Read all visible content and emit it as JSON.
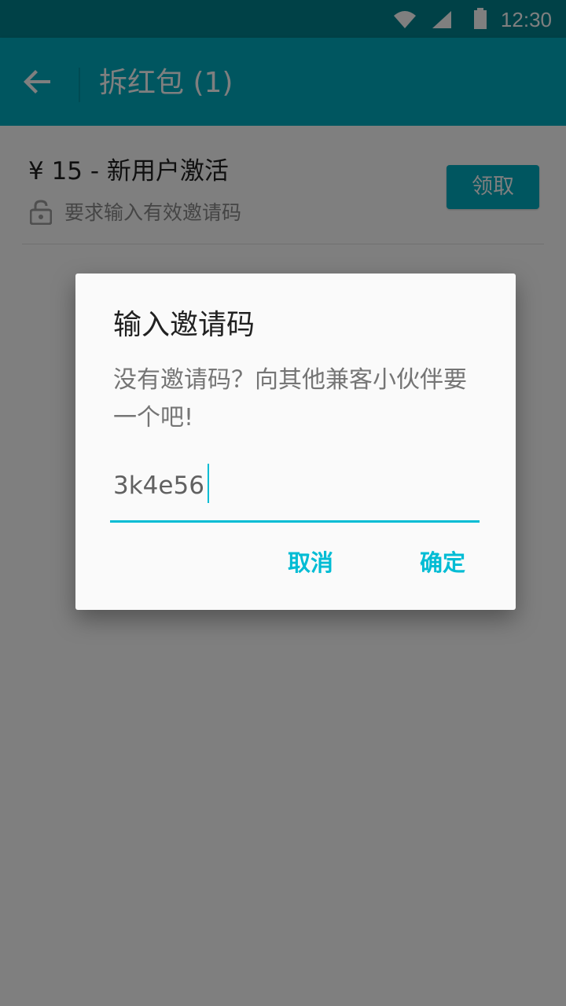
{
  "status_bar": {
    "time": "12:30",
    "icons": [
      "wifi-icon",
      "signal-icon",
      "battery-icon"
    ]
  },
  "toolbar": {
    "title": "拆红包 (1)",
    "back_icon": "arrow-back-icon"
  },
  "list": {
    "items": [
      {
        "amount_text": "¥ 15 - 新用户激活",
        "requirement_text": "要求输入有效邀请码",
        "lock_icon": "lock-open-icon",
        "claim_label": "领取"
      }
    ]
  },
  "dialog": {
    "title": "输入邀请码",
    "message": "没有邀请码？向其他兼客小伙伴要一个吧!",
    "input_value": "3k4e56",
    "cancel_label": "取消",
    "confirm_label": "确定"
  },
  "colors": {
    "status_bar": "#00838f",
    "toolbar": "#00acc1",
    "accent": "#00bcd4",
    "scrim": "rgba(0,0,0,0.5)"
  }
}
